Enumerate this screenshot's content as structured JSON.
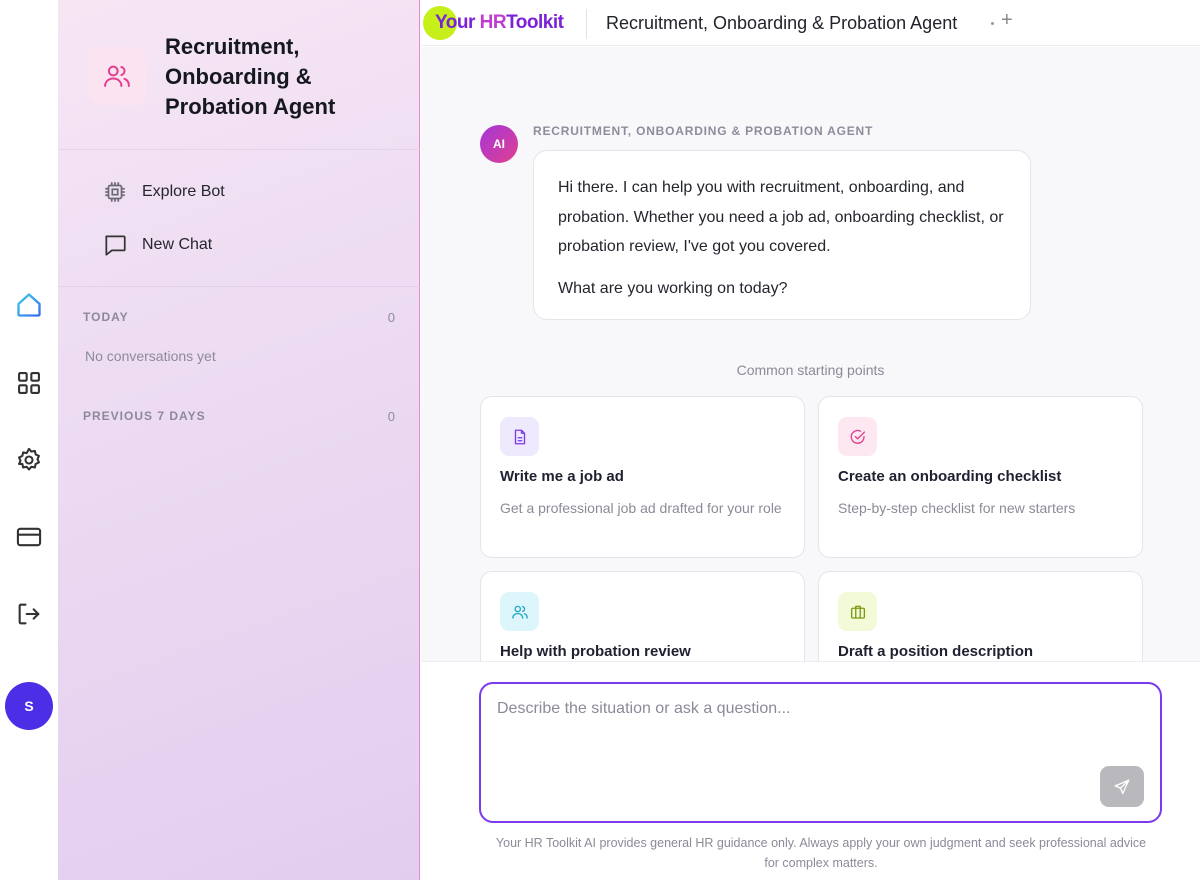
{
  "rail": {
    "items": [
      {
        "name": "home"
      },
      {
        "name": "apps"
      },
      {
        "name": "settings"
      },
      {
        "name": "billing"
      },
      {
        "name": "logout"
      }
    ],
    "avatar_initial": "S"
  },
  "sidebar": {
    "agent_title": "Recruitment, Onboarding & Probation Agent",
    "links": [
      {
        "label": "Explore Bot",
        "icon": "chip-icon"
      },
      {
        "label": "New Chat",
        "icon": "chat-icon"
      }
    ],
    "sections": [
      {
        "label": "TODAY",
        "count": "0",
        "empty_text": "No conversations yet"
      },
      {
        "label": "PREVIOUS 7 DAYS",
        "count": "0"
      }
    ]
  },
  "topbar": {
    "logo_part1": "Your",
    "logo_part2": "HR",
    "logo_part3": "Toolkit",
    "tab_title": "Recruitment, Onboarding & Probation Agent",
    "add_tab": "+"
  },
  "chat": {
    "ai_badge": "AI",
    "agent_label": "RECRUITMENT, ONBOARDING & PROBATION AGENT",
    "message_p1": "Hi there. I can help you with recruitment, onboarding, and probation. Whether you need a job ad, onboarding checklist, or probation review, I've got you covered.",
    "message_p2": "What are you working on today?",
    "starting_label": "Common starting points",
    "cards": [
      {
        "title": "Write me a job ad",
        "desc": "Get a professional job ad drafted for your role",
        "icon": "document-icon",
        "color": "#7c3aed",
        "bg": "#efe9fd"
      },
      {
        "title": "Create an onboarding checklist",
        "desc": "Step-by-step checklist for new starters",
        "icon": "check-circle-icon",
        "color": "#e0408f",
        "bg": "#fde8f2"
      },
      {
        "title": "Help with probation review",
        "desc": "",
        "icon": "users-icon",
        "color": "#22a6c8",
        "bg": "#ddf6fb"
      },
      {
        "title": "Draft a position description",
        "desc": "",
        "icon": "briefcase-icon",
        "color": "#7a9a10",
        "bg": "#f2fad8"
      }
    ]
  },
  "composer": {
    "placeholder": "Describe the situation or ask a question...",
    "value": "",
    "disclaimer": "Your HR Toolkit AI provides general HR guidance only. Always apply your own judgment and seek professional advice for complex matters."
  },
  "colors": {
    "accent": "#7c3aed",
    "avatar": "#4b2ee6",
    "logo_lime": "#c7ef1a",
    "sidebar_border": "#e68bd0"
  }
}
